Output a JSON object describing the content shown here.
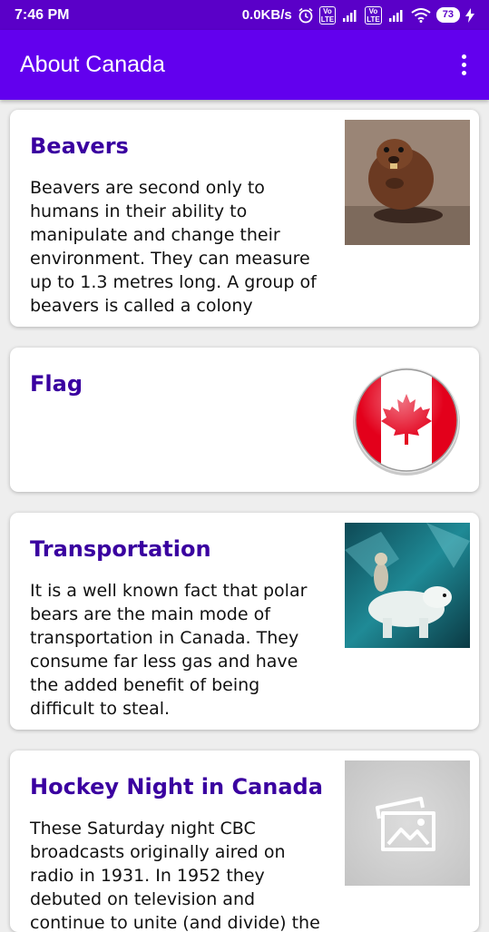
{
  "status_bar": {
    "time": "7:46 PM",
    "network_speed": "0.0KB/s",
    "battery_level": "73",
    "icons": [
      "alarm-icon",
      "volte-icon",
      "signal-icon",
      "volte-icon",
      "signal-icon",
      "wifi-icon",
      "battery-icon",
      "charging-icon"
    ]
  },
  "app_bar": {
    "title": "About Canada",
    "menu_icon": "more-vert-icon"
  },
  "cards": [
    {
      "title": "Beavers",
      "description": "Beavers are second only to humans in their ability to manipulate and change their environment. They can measure up to 1.3 metres long. A group of beavers is called a colony",
      "image": "beaver-photo"
    },
    {
      "title": "Flag",
      "description": "",
      "image": "canada-flag-badge"
    },
    {
      "title": "Transportation",
      "description": "It is a well known fact that polar bears are the main mode of transportation in Canada. They consume far less gas and have the added benefit of being difficult to steal.",
      "image": "polar-bear-photo"
    },
    {
      "title": "Hockey Night in Canada",
      "description": "These Saturday night CBC broadcasts originally aired on radio in 1931. In 1952 they debuted on television and continue to unite (and divide) the nation each week.",
      "image": "image-placeholder-icon"
    }
  ],
  "colors": {
    "status_bar": "#5a00c8",
    "app_bar": "#6200ee",
    "card_title": "#3a00a0",
    "background": "#eeeeee"
  }
}
